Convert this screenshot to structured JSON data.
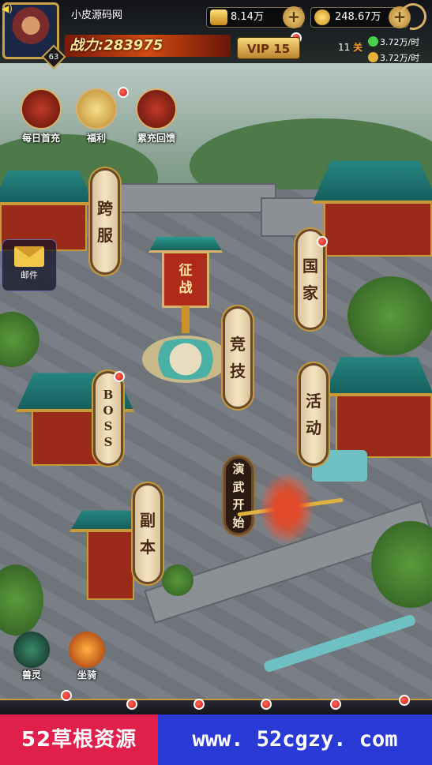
{
  "player": {
    "name": "小皮源码网",
    "level": "63",
    "power": "战力:283975",
    "vip": "VIP 15"
  },
  "resources": {
    "gold": "8.14万",
    "coins": "248.67万"
  },
  "stage": {
    "count": "11",
    "unit": "关",
    "exp_rate": "3.72万/时",
    "gold_rate": "3.72万/时"
  },
  "events": [
    {
      "label": "每日首充",
      "icon": "red-gift-icon"
    },
    {
      "label": "福利",
      "icon": "gold-envelope-icon"
    },
    {
      "label": "累充回馈",
      "icon": "red-bag-icon"
    }
  ],
  "side": {
    "mail_label": "邮件"
  },
  "map": {
    "kuafu": [
      "跨",
      "服"
    ],
    "guojia": [
      "国",
      "家"
    ],
    "zhengzhan": [
      "征",
      "战"
    ],
    "jingji": [
      "竞",
      "技"
    ],
    "boss": [
      "B",
      "O",
      "S",
      "S"
    ],
    "huodong": [
      "活",
      "动"
    ],
    "yanwu": [
      "演",
      "武",
      "开",
      "始"
    ],
    "fuben": [
      "副",
      "本"
    ]
  },
  "pets": [
    {
      "label": "兽灵",
      "icon": "dragon-spirit-icon"
    },
    {
      "label": "坐骑",
      "icon": "fire-mount-icon"
    }
  ],
  "watermark": {
    "left": "52草根资源",
    "right": "www. 52cgzy. com"
  },
  "colors": {
    "accent_gold": "#c99a3a",
    "notify_red": "#d01010",
    "banner_red": "#e01f4a",
    "banner_blue": "#2a3ad6"
  }
}
